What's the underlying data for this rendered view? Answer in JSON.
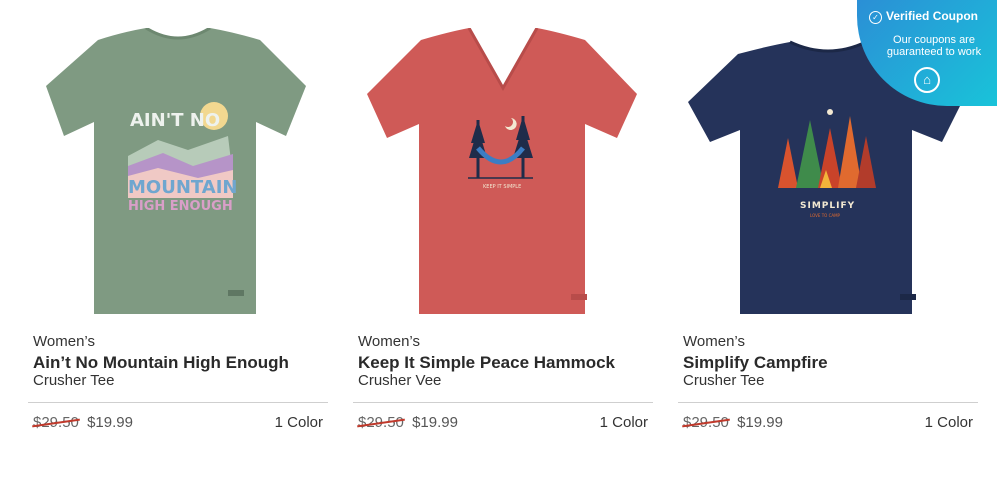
{
  "products": [
    {
      "category": "Women’s",
      "name": "Ain’t No Mountain High Enough",
      "style": "Crusher Tee",
      "original_price": "$29.50",
      "sale_price": "$19.99",
      "colors": "1 Color",
      "shirt_color": "#7f9a82",
      "graphic_text_1": "AIN'T NO",
      "graphic_text_2": "MOUNTAIN",
      "graphic_text_3": "HIGH ENOUGH"
    },
    {
      "category": "Women’s",
      "name": "Keep It Simple Peace Hammock",
      "style": "Crusher Vee",
      "original_price": "$29.50",
      "sale_price": "$19.99",
      "colors": "1 Color",
      "shirt_color": "#cf5a57",
      "graphic_text_1": "KEEP IT SIMPLE"
    },
    {
      "category": "Women’s",
      "name": "Simplify Campfire",
      "style": "Crusher Tee",
      "original_price": "$29.50",
      "sale_price": "$19.99",
      "colors": "1 Color",
      "shirt_color": "#25335a",
      "graphic_text_1": "SIMPLIFY",
      "graphic_text_2": "LOVE TO CAMP"
    }
  ],
  "coupon": {
    "title": "Verified Coupon",
    "subtitle": "Our coupons are guaranteed to work",
    "icon": "check-circle-icon",
    "badge_icon": "coupon-tag-icon"
  },
  "colors": {
    "strike": "#c0392b",
    "coupon_start": "#2b8fd6",
    "coupon_end": "#19c3d9"
  }
}
